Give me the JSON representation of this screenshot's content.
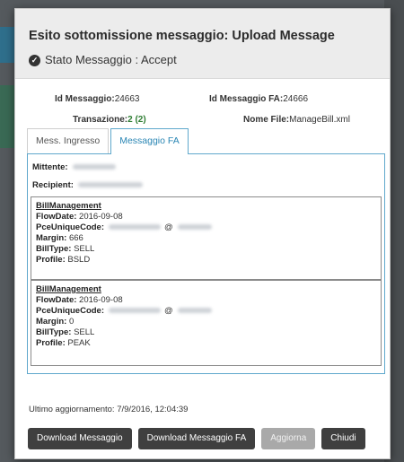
{
  "modal": {
    "title": "Esito sottomissione messaggio: Upload Message",
    "status_label": "Stato Messaggio : Accept"
  },
  "info": {
    "id_messaggio_label": "Id Messaggio:",
    "id_messaggio_value": "24663",
    "id_messaggio_fa_label": "Id Messaggio FA:",
    "id_messaggio_fa_value": "24666",
    "transazione_label": "Transazione:",
    "transazione_value": "2 (2)",
    "nome_file_label": "Nome File:",
    "nome_file_value": "ManageBill.xml"
  },
  "tabs": [
    {
      "label": "Mess. Ingresso",
      "active": false
    },
    {
      "label": "Messaggio FA",
      "active": true
    }
  ],
  "panel": {
    "mittente_label": "Mittente",
    "recipient_label": "Recipient",
    "records": [
      {
        "header": "BillManagement",
        "flowdate_label": "FlowDate",
        "flowdate_value": "2016-09-08",
        "pce_label": "PceUniqueCode",
        "pce_at": "@",
        "margin_label": "Margin",
        "margin_value": "666",
        "billtype_label": "BillType",
        "billtype_value": "SELL",
        "profile_label": "Profile",
        "profile_value": "BSLD"
      },
      {
        "header": "BillManagement",
        "flowdate_label": "FlowDate",
        "flowdate_value": "2016-09-08",
        "pce_label": "PceUniqueCode",
        "pce_at": "@",
        "margin_label": "Margin",
        "margin_value": "0",
        "billtype_label": "BillType",
        "billtype_value": "SELL",
        "profile_label": "Profile",
        "profile_value": "PEAK"
      }
    ]
  },
  "footer": {
    "updated_text": "Ultimo aggiornamento: 7/9/2016, 12:04:39",
    "buttons": {
      "download_messaggio": "Download Messaggio",
      "download_messaggio_fa": "Download Messaggio FA",
      "aggiorna": "Aggiorna",
      "chiudi": "Chiudi"
    }
  },
  "colors": {
    "accent": "#5fa8cc",
    "tab_active_text": "#2a86b4",
    "success_green": "#2e7d32",
    "button_dark": "#3f3f3f",
    "button_disabled": "#a9a9a9"
  },
  "icons": {
    "status": "check-circle-icon"
  }
}
